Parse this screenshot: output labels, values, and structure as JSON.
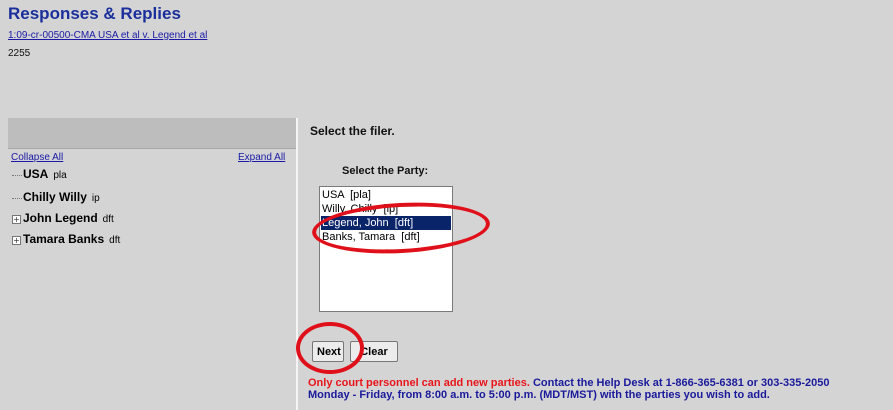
{
  "header": {
    "title": "Responses & Replies",
    "case_link": "1:09-cr-00500-CMA USA et al v. Legend et al",
    "case_number": "2255"
  },
  "tree": {
    "collapse_all": "Collapse All",
    "expand_all": "Expand All",
    "parties": [
      {
        "name": "USA",
        "role": "pla",
        "expandable": false
      },
      {
        "name": "Chilly Willy",
        "role": "ip",
        "expandable": false
      },
      {
        "name": "John Legend",
        "role": "dft",
        "expandable": true
      },
      {
        "name": "Tamara Banks",
        "role": "dft",
        "expandable": true
      }
    ]
  },
  "form": {
    "instruction": "Select the filer.",
    "party_label": "Select the Party:",
    "options": [
      "USA  [pla]",
      "Willy, Chilly  [ip]",
      "Legend, John  [dft]",
      "Banks, Tamara  [dft]"
    ],
    "selected": "Legend, John  [dft]",
    "next_label": "Next",
    "clear_label": "Clear"
  },
  "notice": {
    "red_text": "Only court personnel can add new parties.",
    "blue_text_1": " Contact the Help Desk at 1-866-365-6381 or 303-335-2050",
    "blue_text_2": "Monday - Friday, from 8:00 a.m. to 5:00 p.m. (MDT/MST) with the parties you wish to add."
  },
  "colors": {
    "annotation": "#e0101a",
    "selection": "#0a246a",
    "title": "#1a2f9c"
  }
}
